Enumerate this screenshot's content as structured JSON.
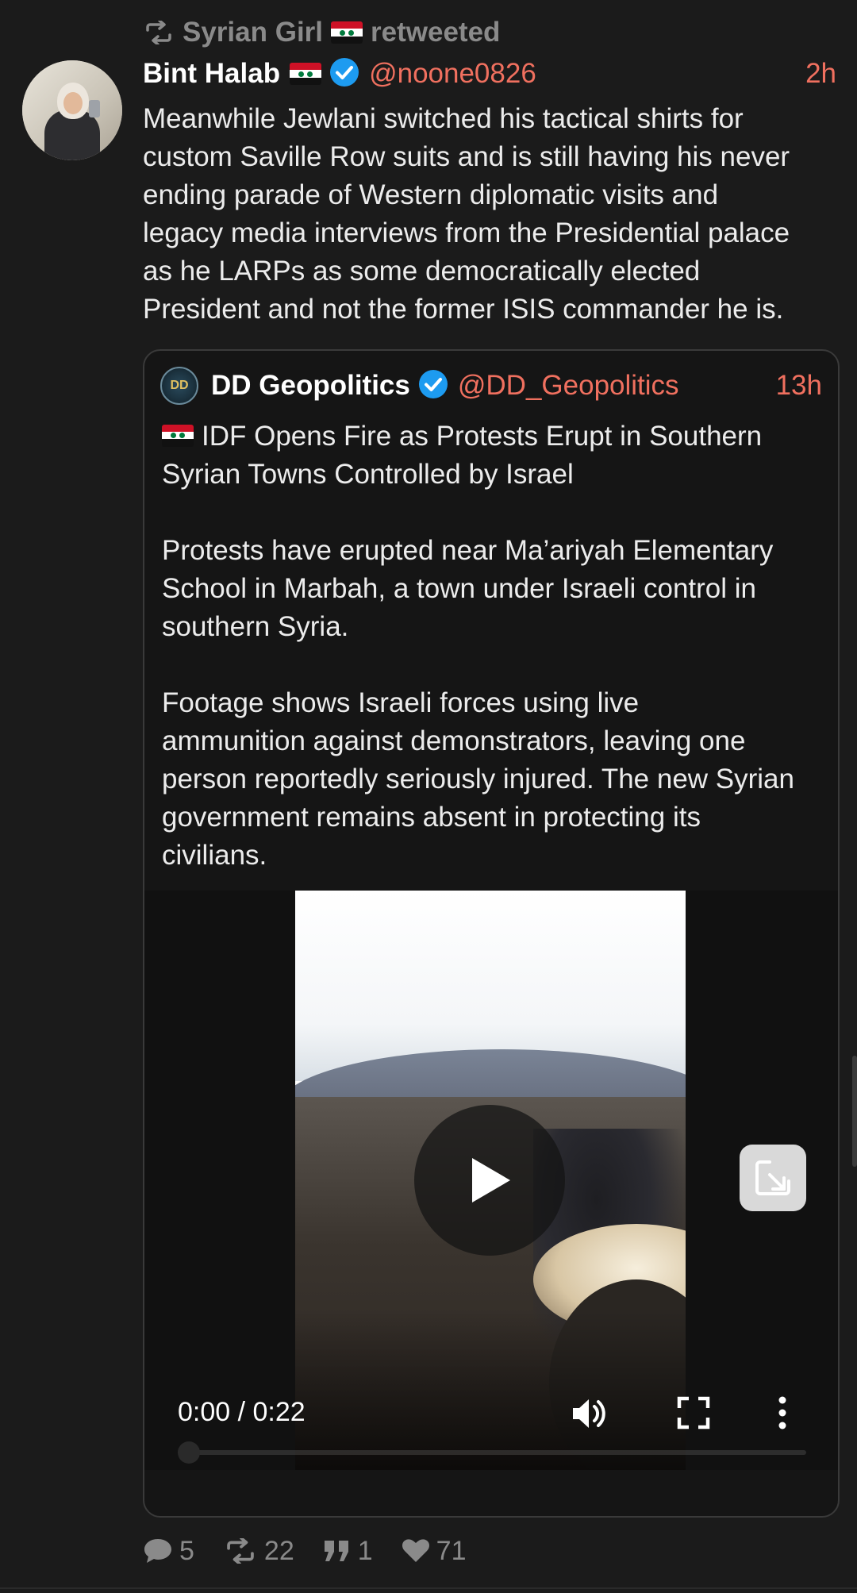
{
  "retweet": {
    "retweeter_name": "Syrian Girl",
    "label": "retweeted"
  },
  "tweet": {
    "author_name": "Bint Halab",
    "handle": "@noone0826",
    "time": "2h",
    "text": "Meanwhile Jewlani switched his tactical shirts for\ncustom Saville Row suits and is still having his never\nending parade of Western diplomatic visits and\nlegacy media interviews from the Presidential palace\nas he LARPs as some democratically elected\nPresident and not the former ISIS commander he is."
  },
  "quote": {
    "avatar_text": "DD",
    "author_name": "DD Geopolitics",
    "handle": "@DD_Geopolitics",
    "time": "13h",
    "title": "IDF Opens Fire as Protests Erupt in Southern Syrian Towns Controlled by Israel",
    "body": "Protests have erupted near Ma’ariyah Elementary\nSchool in Marbah, a town under Israeli control in\nsouthern Syria.\n\nFootage shows Israeli forces using live\nammunition against demonstrators, leaving one\nperson reportedly seriously injured. The new Syrian\ngovernment remains absent in protecting its\ncivilians.",
    "video": {
      "timecode": "0:00 / 0:22",
      "progress": 0
    }
  },
  "actions": {
    "replies": "5",
    "retweets": "22",
    "quotes": "1",
    "likes": "71"
  },
  "colors": {
    "background": "#1b1b1b",
    "accent": "#f0705f",
    "verified": "#1d9bf0",
    "muted": "#8a8a8a"
  }
}
